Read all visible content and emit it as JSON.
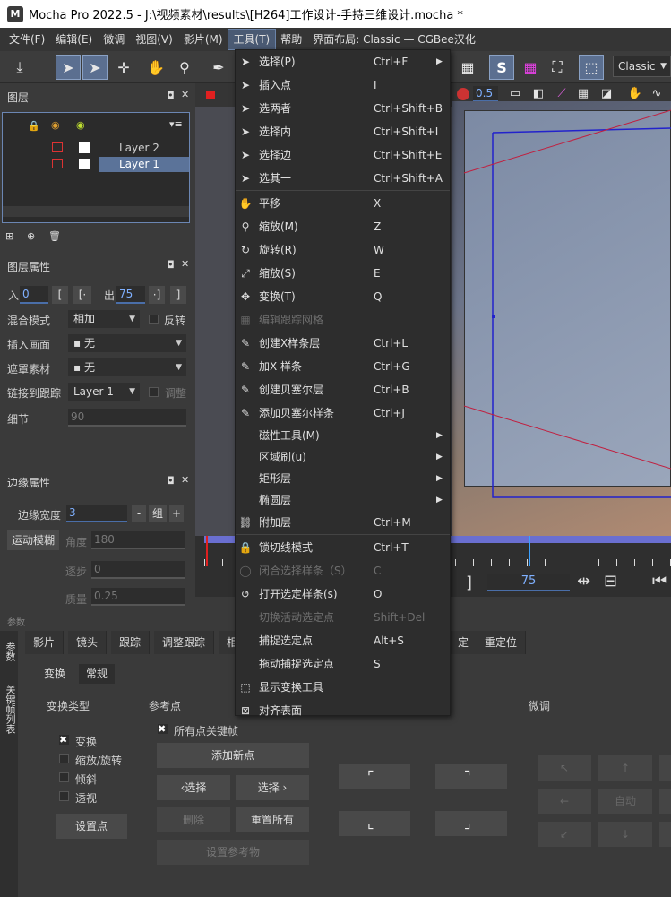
{
  "titlebar": {
    "app_icon": "M",
    "title": "Mocha Pro 2022.5 - J:\\视频素材\\results\\[H264]工作设计-手持三维设计.mocha *"
  },
  "menubar": {
    "items": [
      "文件(F)",
      "编辑(E)",
      "微调",
      "视图(V)",
      "影片(M)",
      "工具(T)",
      "帮助",
      "界面布局: Classic — CGBee汉化"
    ]
  },
  "toolbar": {
    "layout_select": "Classic",
    "s_badge": "S",
    "zoom_value": "0.5"
  },
  "layers_panel": {
    "title": "图层",
    "layers": [
      "Layer 2",
      "Layer 1"
    ]
  },
  "layer_props": {
    "title": "图层属性",
    "in_label": "入",
    "in_value": "0",
    "out_label": "出",
    "out_value": "75",
    "blend_label": "混合模式",
    "blend_value": "相加",
    "invert_label": "反转",
    "insert_label": "插入画面",
    "insert_value": "无",
    "matte_label": "遮罩素材",
    "matte_value": "无",
    "link_label": "链接到跟踪",
    "link_value": "Layer 1",
    "adjust_label": "调整",
    "detail_label": "细节",
    "detail_value": "90"
  },
  "edge_props": {
    "title": "边缘属性",
    "width_label": "边缘宽度",
    "width_value": "3",
    "group_label": "组",
    "motion_blur_btn": "运动模糊",
    "angle_label": "角度",
    "angle_value": "180",
    "step_label": "逐步",
    "step_value": "0",
    "quality_label": "质量",
    "quality_value": "0.25"
  },
  "timeline": {
    "frame": "75"
  },
  "bottom_tabs": [
    "影片",
    "镜头",
    "跟踪",
    "调整跟踪",
    "相",
    "定",
    "重定位"
  ],
  "side_tabs": {
    "params": "参数",
    "keyframes": "关键帧列表",
    "params_header": "参数"
  },
  "transform": {
    "sub_tabs": [
      "变换",
      "常规"
    ],
    "type_label": "变换类型",
    "ref_label": "参考点",
    "fine_label": "微调",
    "type_options": [
      "变换",
      "缩放/旋转",
      "倾斜",
      "透视"
    ],
    "all_keys_label": "所有点关键帧",
    "add_point": "添加新点",
    "prev_select": "‹选择",
    "next_select": "选择 ›",
    "delete": "删除",
    "reset_all": "重置所有",
    "set_ref": "设置参考物",
    "set_point": "设置点",
    "auto": "自动"
  },
  "tools_menu": {
    "items": [
      {
        "label": "选择(P)",
        "shortcut": "Ctrl+F",
        "icon": "select-icon",
        "submenu": true
      },
      {
        "label": "插入点",
        "shortcut": "I",
        "icon": "insert-point-icon"
      },
      {
        "label": "选两者",
        "shortcut": "Ctrl+Shift+B",
        "icon": "select-both-icon"
      },
      {
        "label": "选择内",
        "shortcut": "Ctrl+Shift+I",
        "icon": "select-inner-icon"
      },
      {
        "label": "选择边",
        "shortcut": "Ctrl+Shift+E",
        "icon": "select-edge-icon"
      },
      {
        "label": "选其一",
        "shortcut": "Ctrl+Shift+A",
        "icon": "select-one-icon"
      },
      {
        "label": "平移",
        "shortcut": "X",
        "icon": "hand-icon"
      },
      {
        "label": "缩放(M)",
        "shortcut": "Z",
        "icon": "zoom-icon"
      },
      {
        "label": "旋转(R)",
        "shortcut": "W",
        "icon": "rotate-icon"
      },
      {
        "label": "缩放(S)",
        "shortcut": "E",
        "icon": "scale-icon"
      },
      {
        "label": "变换(T)",
        "shortcut": "Q",
        "icon": "transform-icon"
      },
      {
        "label": "编辑跟踪网格",
        "shortcut": "",
        "icon": "grid-icon",
        "disabled": true
      },
      {
        "label": "创建X样条层",
        "shortcut": "Ctrl+L",
        "icon": "xspline-create-icon"
      },
      {
        "label": "加X-样条",
        "shortcut": "Ctrl+G",
        "icon": "xspline-add-icon"
      },
      {
        "label": "创建贝塞尔层",
        "shortcut": "Ctrl+B",
        "icon": "bezier-create-icon"
      },
      {
        "label": "添加贝塞尔样条",
        "shortcut": "Ctrl+J",
        "icon": "bezier-add-icon"
      },
      {
        "label": "磁性工具(M)",
        "shortcut": "",
        "icon": "",
        "submenu": true
      },
      {
        "label": "区域刷(u)",
        "shortcut": "",
        "icon": "",
        "submenu": true
      },
      {
        "label": "矩形层",
        "shortcut": "",
        "icon": "",
        "submenu": true
      },
      {
        "label": "椭圆层",
        "shortcut": "",
        "icon": "",
        "submenu": true
      },
      {
        "label": "附加层",
        "shortcut": "Ctrl+M",
        "icon": "link-icon"
      },
      {
        "label": "锁切线模式",
        "shortcut": "Ctrl+T",
        "icon": "lock-icon"
      },
      {
        "label": "闭合选择样条（S）",
        "shortcut": "C",
        "icon": "close-spline-icon",
        "disabled": true
      },
      {
        "label": "打开选定样条(s)",
        "shortcut": "O",
        "icon": "open-spline-icon"
      },
      {
        "label": "切换活动选定点",
        "shortcut": "Shift+Del",
        "icon": "",
        "disabled": true
      },
      {
        "label": "捕捉选定点",
        "shortcut": "Alt+S",
        "icon": ""
      },
      {
        "label": "拖动捕捉选定点",
        "shortcut": "S",
        "icon": ""
      },
      {
        "label": "显示变换工具",
        "shortcut": "",
        "icon": "transform-tool-icon"
      },
      {
        "label": "对齐表面",
        "shortcut": "",
        "icon": "align-surface-icon"
      }
    ]
  },
  "colors": {
    "accent": "#5b7399",
    "menu_bg": "#2d2d2d",
    "panel_bg": "#3a3a3a",
    "field_blue": "#7fb0ff",
    "timeline_purple": "#6a6fd1"
  }
}
